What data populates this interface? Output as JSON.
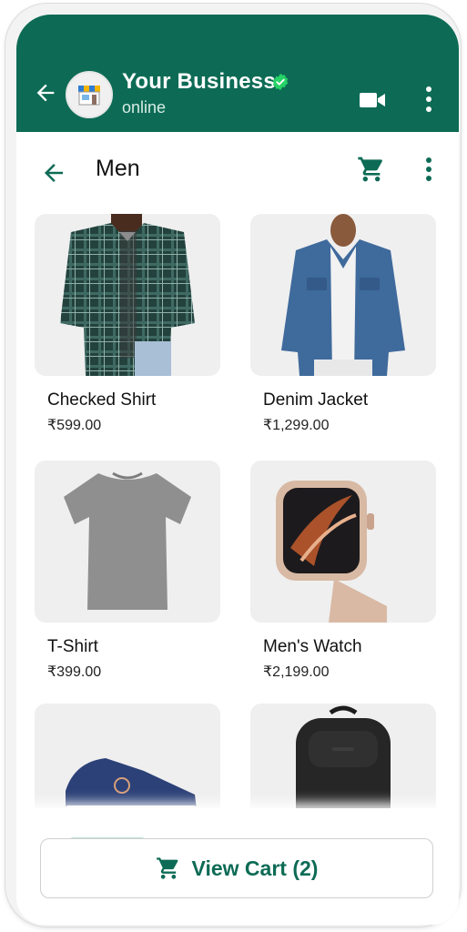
{
  "header": {
    "business_name": "Your Business",
    "status": "online",
    "brand_color": "#0d6b55",
    "icons": [
      "back-arrow-icon",
      "store-avatar-icon",
      "verified-badge-icon",
      "video-call-icon",
      "more-vert-icon"
    ]
  },
  "catalog": {
    "title": "Men",
    "icons": [
      "back-arrow-icon",
      "cart-icon",
      "more-vert-icon"
    ]
  },
  "products": [
    {
      "name": "Checked Shirt",
      "price": "₹599.00"
    },
    {
      "name": "Denim Jacket",
      "price": "₹1,299.00"
    },
    {
      "name": "T-Shirt",
      "price": "₹399.00"
    },
    {
      "name": "Men's Watch",
      "price": "₹2,199.00"
    },
    {
      "name": "",
      "price": ""
    },
    {
      "name": "",
      "price": ""
    }
  ],
  "footer": {
    "view_cart_label": "View Cart (2)",
    "icon": "cart-icon"
  }
}
